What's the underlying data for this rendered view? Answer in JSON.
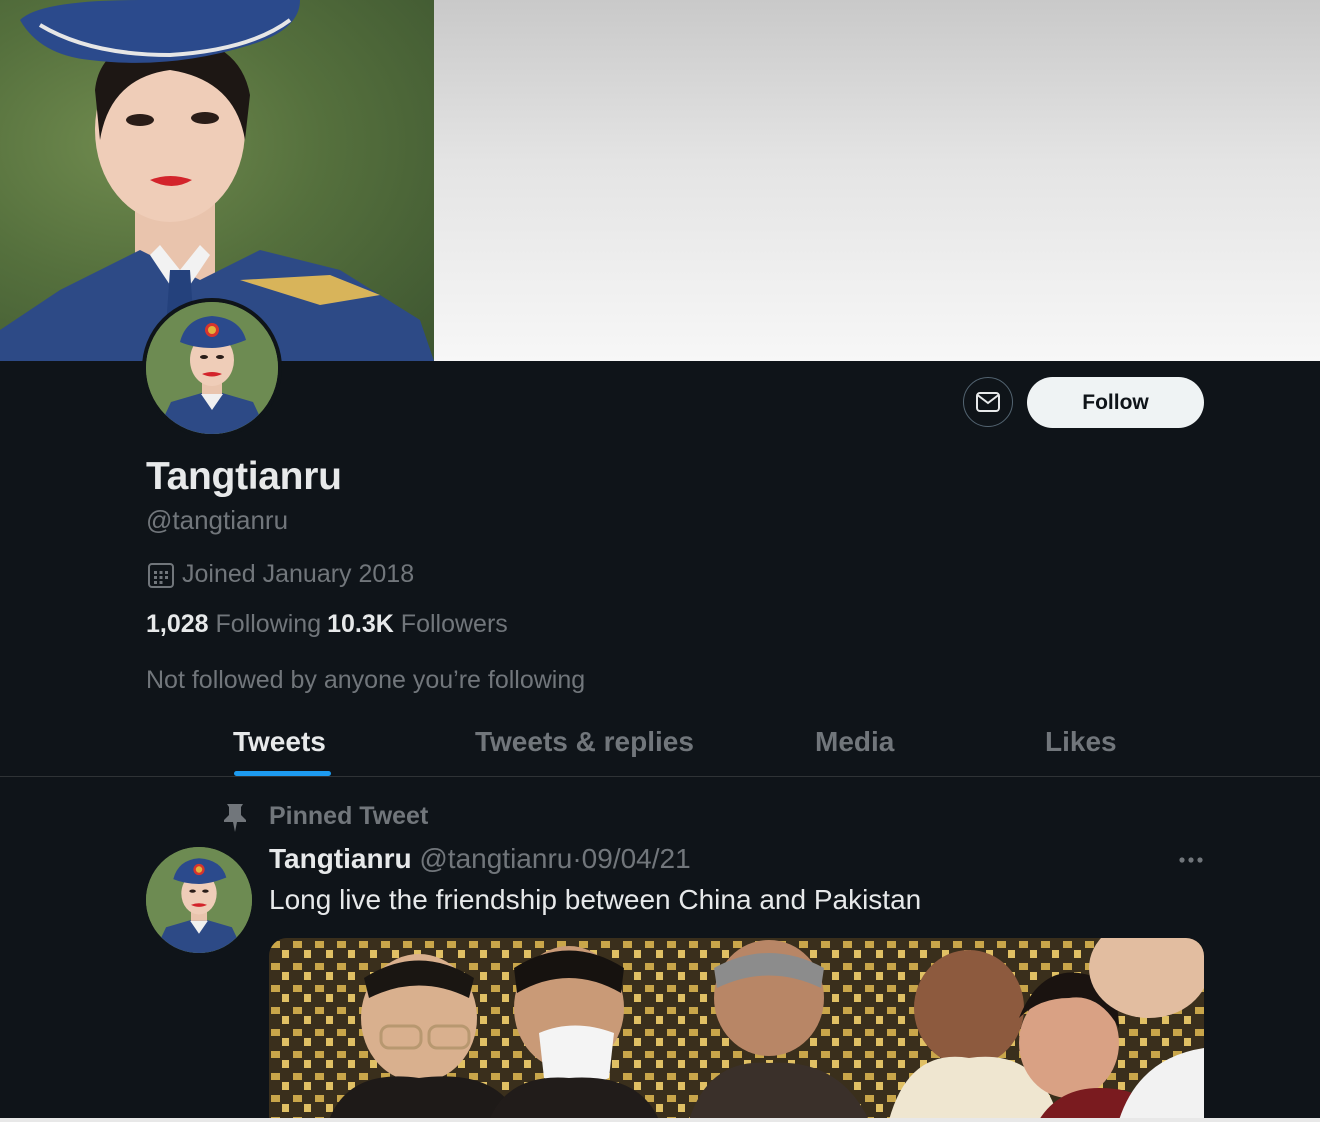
{
  "profile": {
    "display_name": "Tangtianru",
    "handle": "@tangtianru",
    "joined": "Joined January 2018",
    "following_count": "1,028",
    "following_label": "Following",
    "followers_count": "10.3K",
    "followers_label": "Followers",
    "not_followed_text": "Not followed by anyone you’re following"
  },
  "actions": {
    "follow_label": "Follow",
    "message_icon": "envelope-icon"
  },
  "tabs": [
    {
      "label": "Tweets",
      "active": true
    },
    {
      "label": "Tweets & replies",
      "active": false
    },
    {
      "label": "Media",
      "active": false
    },
    {
      "label": "Likes",
      "active": false
    }
  ],
  "pinned_tweet": {
    "pinned_label": "Pinned Tweet",
    "author_name": "Tangtianru",
    "author_handle": "@tangtianru",
    "separator": "·",
    "date": "09/04/21",
    "text": "Long live the friendship between China and Pakistan"
  },
  "colors": {
    "background": "#0f1419",
    "accent": "#1d9bf0",
    "secondary_text": "#71767b",
    "primary_text": "#e7e9ea"
  }
}
